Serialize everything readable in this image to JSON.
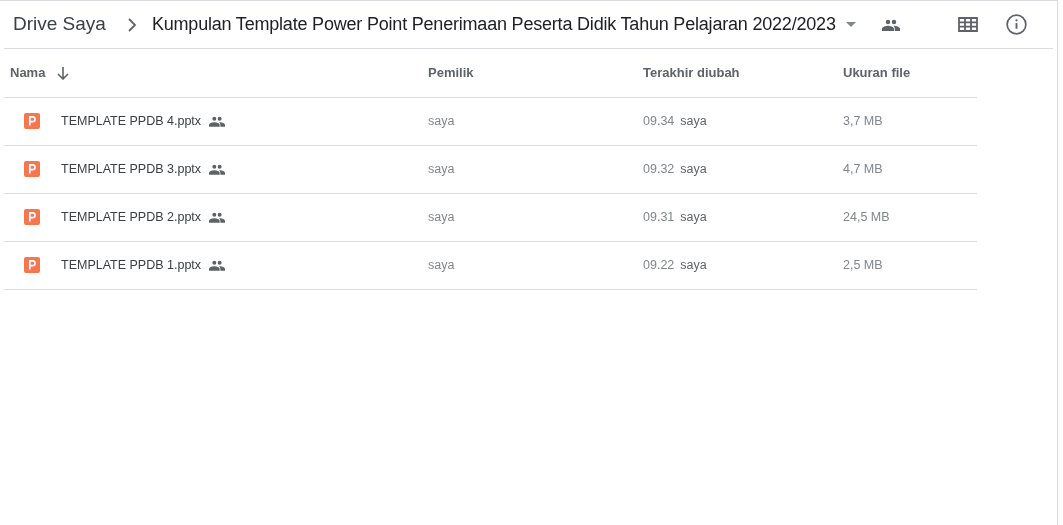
{
  "breadcrumb": [
    "Drive Saya",
    "Kumpulan Template Power Point Penerimaan Peserta Didik Tahun Pelajaran 2022/2023"
  ],
  "table": {
    "columns": [
      "Nama",
      "Pemilik",
      "Terakhir diubah",
      "Ukuran file"
    ],
    "rows": [
      {
        "name": "TEMPLATE PPDB 4.pptx",
        "shared": true,
        "owner": "saya",
        "modified_time": "09.34",
        "modified_by": "saya",
        "size": "3,7 MB"
      },
      {
        "name": "TEMPLATE PPDB 3.pptx",
        "shared": true,
        "owner": "saya",
        "modified_time": "09.32",
        "modified_by": "saya",
        "size": "4,7 MB"
      },
      {
        "name": "TEMPLATE PPDB 2.pptx",
        "shared": true,
        "owner": "saya",
        "modified_time": "09.31",
        "modified_by": "saya",
        "size": "24,5 MB"
      },
      {
        "name": "TEMPLATE PPDB 1.pptx",
        "shared": true,
        "owner": "saya",
        "modified_time": "09.22",
        "modified_by": "saya",
        "size": "2,5 MB"
      }
    ]
  }
}
